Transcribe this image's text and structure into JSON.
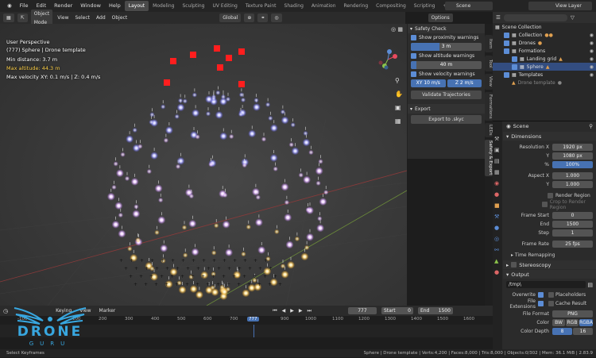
{
  "menubar": {
    "items": [
      "File",
      "Edit",
      "Render",
      "Window",
      "Help"
    ]
  },
  "workspaces": {
    "active": "Layout",
    "items": [
      "Layout",
      "Modeling",
      "Sculpting",
      "UV Editing",
      "Texture Paint",
      "Shading",
      "Animation",
      "Rendering",
      "Compositing",
      "Scripting"
    ]
  },
  "scene_field": "Scene",
  "view_layer_field": "View Layer",
  "viewport_header": {
    "mode": "Object Mode",
    "menus": [
      "View",
      "Select",
      "Add",
      "Object"
    ],
    "transform": "Global",
    "options": "Options"
  },
  "overlay": {
    "title": "User Perspective",
    "subtitle": "(777) Sphere | Drone template",
    "min_distance": "Min distance: 3.7 m",
    "max_altitude": "Max altitude: 44.3 m",
    "max_velocity": "Max velocity XY: 0.1 m/s | Z: 0.4 m/s"
  },
  "safety_panel": {
    "header": "Safety Check",
    "show_proximity": "Show proximity warnings",
    "proximity_value": "3 m",
    "show_altitude": "Show altitude warnings",
    "altitude_value": "40 m",
    "show_velocity": "Show velocity warnings",
    "xy_label": "XY",
    "xy_value": "10 m/s",
    "z_label": "Z",
    "z_value": "2 m/s",
    "validate_button": "Validate Trajectories",
    "export_header": "Export",
    "export_button": "Export to .skyc"
  },
  "sidebar_tabs": [
    "Item",
    "Tool",
    "View",
    "Formations",
    "LEDs",
    "Safety & Export"
  ],
  "outliner": {
    "rows": [
      {
        "label": "Scene Collection"
      },
      {
        "label": "Collection"
      },
      {
        "label": "Drones"
      },
      {
        "label": "Formations"
      },
      {
        "label": "Landing grid"
      },
      {
        "label": "Sphere"
      },
      {
        "label": "Templates"
      },
      {
        "label": "Drone template"
      }
    ]
  },
  "properties": {
    "scene_label": "Scene",
    "dimensions_header": "Dimensions",
    "resolution_x_label": "Resolution X",
    "resolution_x": "1920 px",
    "y_label": "Y",
    "resolution_y": "1080 px",
    "percent_label": "%",
    "percent": "100%",
    "aspect_x_label": "Aspect X",
    "aspect_x": "1.000",
    "aspect_y": "1.000",
    "render_region": "Render Region",
    "crop_region": "Crop to Render Region",
    "frame_start_label": "Frame Start",
    "frame_start": "0",
    "end_label": "End",
    "frame_end": "1500",
    "step_label": "Step",
    "step": "1",
    "frame_rate_label": "Frame Rate",
    "frame_rate": "25 fps",
    "time_remapping": "Time Remapping",
    "stereoscopy": "Stereoscopy",
    "output_header": "Output",
    "output_path": "/tmp\\",
    "overwrite": "Overwrite",
    "placeholders": "Placeholders",
    "file_extensions": "File Extensions",
    "cache_result": "Cache Result",
    "file_format_label": "File Format",
    "file_format": "PNG",
    "color_label": "Color",
    "color_bw": "BW",
    "color_rgb": "RGB",
    "color_rgba": "RGBA",
    "color_depth_label": "Color Depth",
    "color_depth_8": "8",
    "color_depth_16": "16"
  },
  "timeline": {
    "keying": "Keying",
    "view": "View",
    "marker": "Marker",
    "current_frame": "777",
    "start_label": "Start",
    "start": "0",
    "end_label": "End",
    "end": "1500",
    "ticks": [
      "-100",
      "0",
      "100",
      "200",
      "300",
      "400",
      "500",
      "600",
      "700",
      "777",
      "900",
      "1000",
      "1100",
      "1200",
      "1300",
      "1400",
      "1500",
      "1600"
    ]
  },
  "status": {
    "left": "Select Keyframes",
    "right": "Sphere | Drone template | Verts:4,200 | Faces:8,000 | Tris:8,000 | Objects:0/302 | Mem: 36.1 MiB | 2.83.9"
  },
  "logo": {
    "line1": "DRONE",
    "line2": "GURU"
  }
}
